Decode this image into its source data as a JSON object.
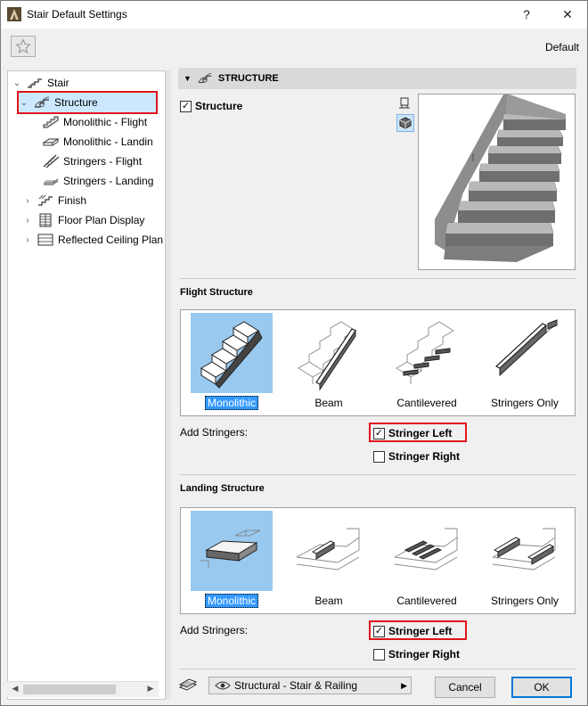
{
  "window": {
    "title": "Stair Default Settings",
    "help_label": "?",
    "close_label": "✕"
  },
  "toolbar": {
    "favorite_icon": "star-icon",
    "preset_label": "Default"
  },
  "tree": {
    "items": [
      {
        "label": "Stair",
        "icon": "stair-icon",
        "twisty": "⌄"
      },
      {
        "label": "Structure",
        "icon": "structure-icon",
        "twisty": "⌄"
      },
      {
        "label": "Monolithic - Flight",
        "icon": "monolithic-flight-icon"
      },
      {
        "label": "Monolithic - Landin",
        "icon": "monolithic-landing-icon"
      },
      {
        "label": "Stringers - Flight",
        "icon": "stringers-flight-icon"
      },
      {
        "label": "Stringers - Landing",
        "icon": "stringers-landing-icon"
      },
      {
        "label": "Finish",
        "icon": "finish-icon",
        "twisty": "›"
      },
      {
        "label": "Floor Plan Display",
        "icon": "floor-plan-icon",
        "twisty": "›"
      },
      {
        "label": "Reflected Ceiling Plan",
        "icon": "ceiling-plan-icon",
        "twisty": "›"
      }
    ]
  },
  "panel": {
    "header": "STRUCTURE",
    "structure_checkbox": {
      "label": "Structure",
      "checked": true
    },
    "flight": {
      "title": "Flight Structure",
      "options": [
        "Monolithic",
        "Beam",
        "Cantilevered",
        "Stringers Only"
      ],
      "selected": "Monolithic",
      "add_stringers_label": "Add Stringers:",
      "stringer_left": {
        "label": "Stringer Left",
        "checked": true
      },
      "stringer_right": {
        "label": "Stringer Right",
        "checked": false
      }
    },
    "landing": {
      "title": "Landing Structure",
      "options": [
        "Monolithic",
        "Beam",
        "Cantilevered",
        "Stringers Only"
      ],
      "selected": "Monolithic",
      "add_stringers_label": "Add Stringers:",
      "stringer_left": {
        "label": "Stringer Left",
        "checked": true
      },
      "stringer_right": {
        "label": "Stringer Right",
        "checked": false
      }
    }
  },
  "footer": {
    "layer_value": "Structural - Stair & Railing",
    "cancel_label": "Cancel",
    "ok_label": "OK"
  },
  "colors": {
    "selection_bg": "#cce8ff",
    "highlight": "#e2141c",
    "accent": "#0078d7"
  }
}
